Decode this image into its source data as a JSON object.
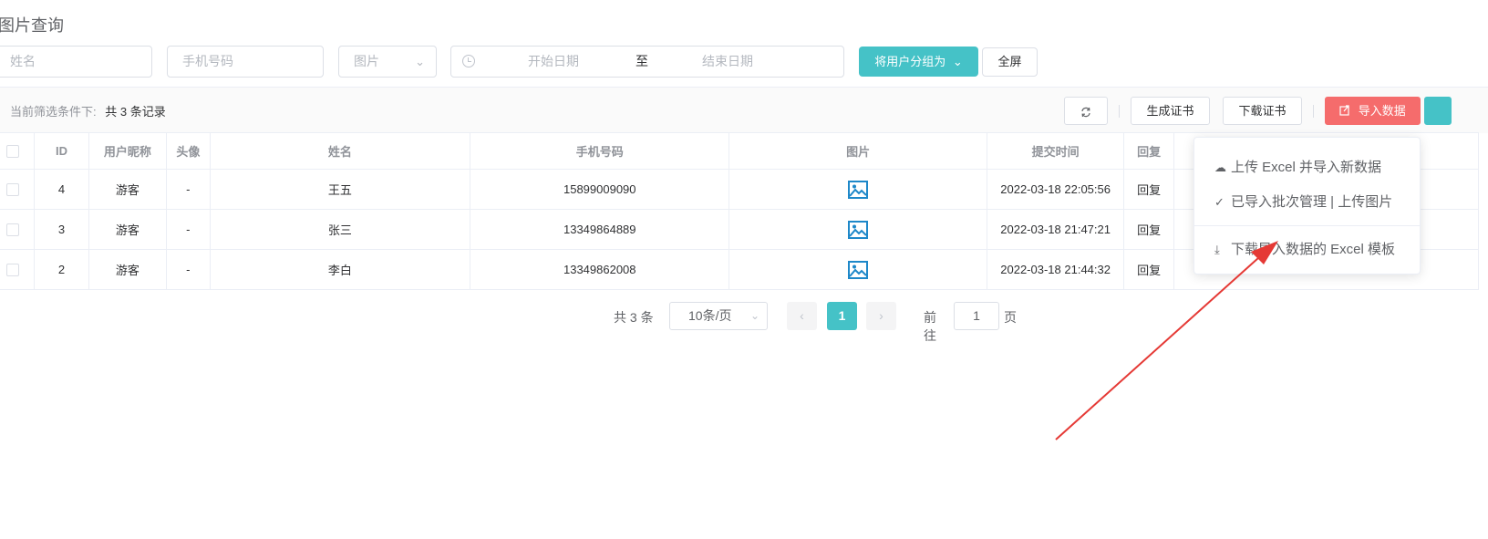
{
  "page": {
    "title": "图片查询"
  },
  "filters": {
    "name_placeholder": "姓名",
    "phone_placeholder": "手机号码",
    "image_select_placeholder": "图片",
    "date_start_placeholder": "开始日期",
    "date_separator": "至",
    "date_end_placeholder": "结束日期",
    "group_button": "将用户分组为",
    "fullscreen_button": "全屏"
  },
  "toolbar": {
    "filter_label": "当前筛选条件下:",
    "filter_count": "共 3 条记录",
    "refresh_icon": "refresh-icon",
    "generate_cert": "生成证书",
    "download_cert": "下载证书",
    "import_data": "导入数据"
  },
  "table": {
    "headers": [
      "ID",
      "用户昵称",
      "头像",
      "姓名",
      "手机号码",
      "图片",
      "提交时间",
      "回复"
    ],
    "rows": [
      {
        "id": "4",
        "nickname": "游客",
        "avatar": "-",
        "name": "王五",
        "phone": "15899009090",
        "image": "image-icon",
        "time": "2022-03-18 22:05:56",
        "reply": "回复"
      },
      {
        "id": "3",
        "nickname": "游客",
        "avatar": "-",
        "name": "张三",
        "phone": "13349864889",
        "image": "image-icon",
        "time": "2022-03-18 21:47:21",
        "reply": "回复"
      },
      {
        "id": "2",
        "nickname": "游客",
        "avatar": "-",
        "name": "李白",
        "phone": "13349862008",
        "image": "image-icon",
        "time": "2022-03-18 21:44:32",
        "reply": "回复"
      }
    ]
  },
  "pagination": {
    "total": "共 3 条",
    "page_size": "10条/页",
    "current_page": "1",
    "goto_label": "前往",
    "goto_value": "1",
    "goto_suffix": "页"
  },
  "import_menu": {
    "items": [
      {
        "icon": "cloud-upload-icon",
        "label": "上传 Excel 并导入新数据"
      },
      {
        "icon": "check-list-icon",
        "label": "已导入批次管理 | 上传图片"
      },
      {
        "icon": "download-icon",
        "label": "下载导入数据的 Excel 模板"
      }
    ]
  },
  "colors": {
    "accent": "#45c2c7",
    "danger": "#f56c6c",
    "annotation_arrow": "#e53935"
  }
}
